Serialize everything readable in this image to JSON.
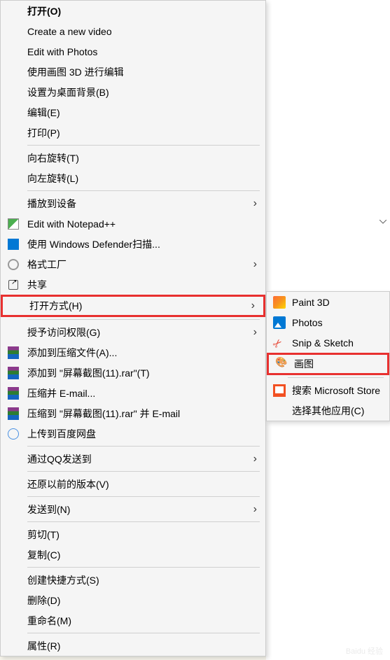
{
  "main_menu": {
    "items": [
      {
        "label": "打开(O)",
        "bold": true
      },
      {
        "label": "Create a new video"
      },
      {
        "label": "Edit with Photos"
      },
      {
        "label": "使用画图 3D 进行编辑"
      },
      {
        "label": "设置为桌面背景(B)"
      },
      {
        "label": "编辑(E)"
      },
      {
        "label": "打印(P)"
      }
    ],
    "items2": [
      {
        "label": "向右旋转(T)"
      },
      {
        "label": "向左旋转(L)"
      }
    ],
    "items3": [
      {
        "label": "播放到设备",
        "arrow": true
      },
      {
        "label": "Edit with Notepad++",
        "icon": "notepad"
      },
      {
        "label": "使用 Windows Defender扫描...",
        "icon": "defender"
      },
      {
        "label": "格式工厂",
        "icon": "gear",
        "arrow": true
      },
      {
        "label": "共享",
        "icon": "share"
      },
      {
        "label": "打开方式(H)",
        "arrow": true,
        "highlighted": true
      }
    ],
    "items4": [
      {
        "label": "授予访问权限(G)",
        "arrow": true
      },
      {
        "label": "添加到压缩文件(A)...",
        "icon": "rar"
      },
      {
        "label": "添加到 \"屏幕截图(11).rar\"(T)",
        "icon": "rar"
      },
      {
        "label": "压缩并 E-mail...",
        "icon": "rar"
      },
      {
        "label": "压缩到 \"屏幕截图(11).rar\" 并 E-mail",
        "icon": "rar"
      },
      {
        "label": "上传到百度网盘",
        "icon": "baidu"
      }
    ],
    "items5": [
      {
        "label": "通过QQ发送到",
        "arrow": true
      }
    ],
    "items6": [
      {
        "label": "还原以前的版本(V)"
      }
    ],
    "items7": [
      {
        "label": "发送到(N)",
        "arrow": true
      }
    ],
    "items8": [
      {
        "label": "剪切(T)"
      },
      {
        "label": "复制(C)"
      }
    ],
    "items9": [
      {
        "label": "创建快捷方式(S)"
      },
      {
        "label": "删除(D)"
      },
      {
        "label": "重命名(M)"
      }
    ],
    "items10": [
      {
        "label": "属性(R)"
      }
    ]
  },
  "submenu": {
    "items": [
      {
        "label": "Paint 3D",
        "icon": "paint3d"
      },
      {
        "label": "Photos",
        "icon": "photos"
      },
      {
        "label": "Snip & Sketch",
        "icon": "snip"
      },
      {
        "label": "画图",
        "icon": "paint",
        "highlighted": true
      }
    ],
    "items2": [
      {
        "label": "搜索 Microsoft Store",
        "icon": "store"
      },
      {
        "label": "选择其他应用(C)"
      }
    ]
  },
  "watermark": "Baidu 经验"
}
